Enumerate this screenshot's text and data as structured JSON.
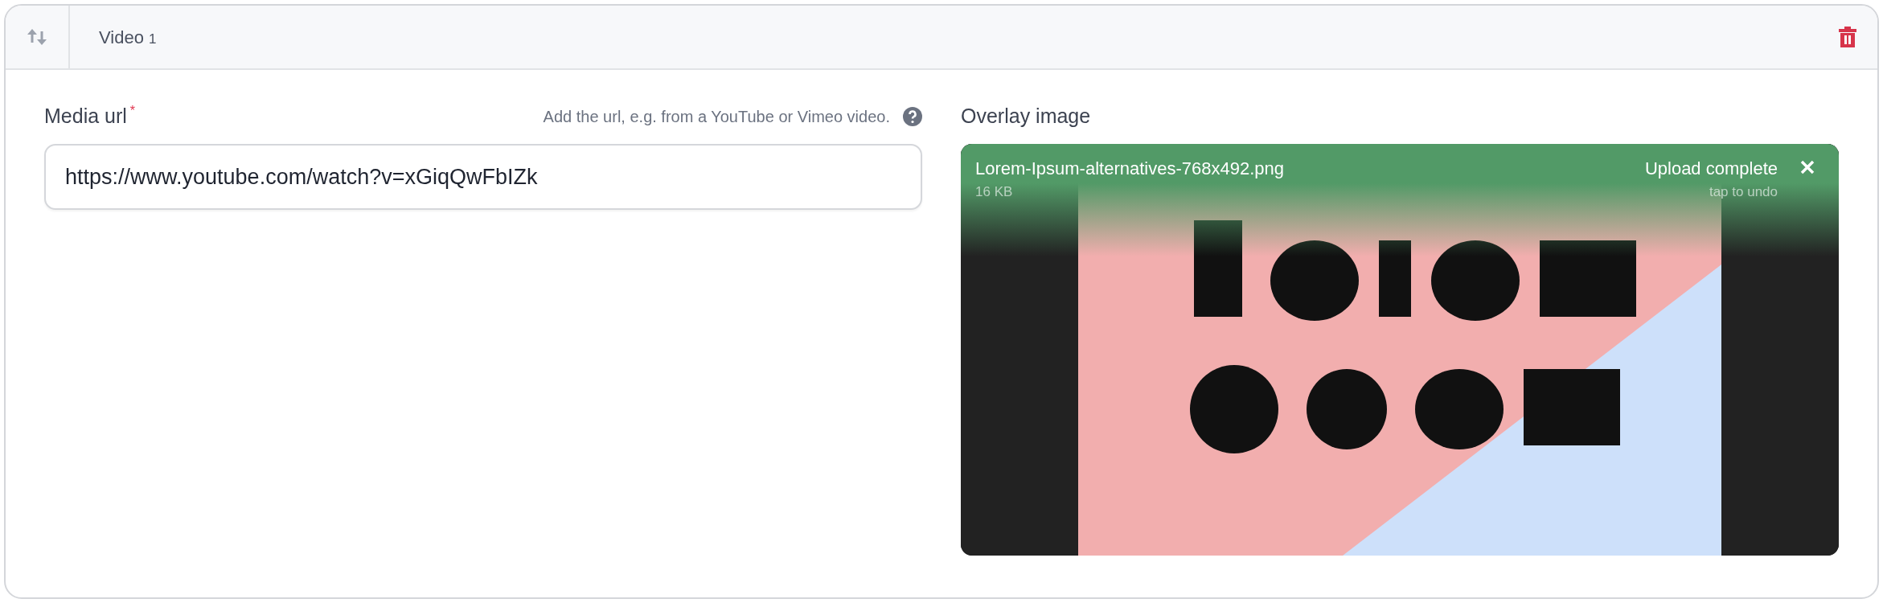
{
  "block": {
    "title": "Video",
    "number": "1"
  },
  "media_url": {
    "label": "Media url",
    "required_mark": "*",
    "hint": "Add the url, e.g. from a YouTube or Vimeo video.",
    "value": "https://www.youtube.com/watch?v=xGiqQwFbIZk"
  },
  "overlay_image": {
    "label": "Overlay image",
    "file_name": "Lorem-Ipsum-alternatives-768x492.png",
    "file_size": "16 KB",
    "status": "Upload complete",
    "undo_hint": "tap to undo"
  }
}
